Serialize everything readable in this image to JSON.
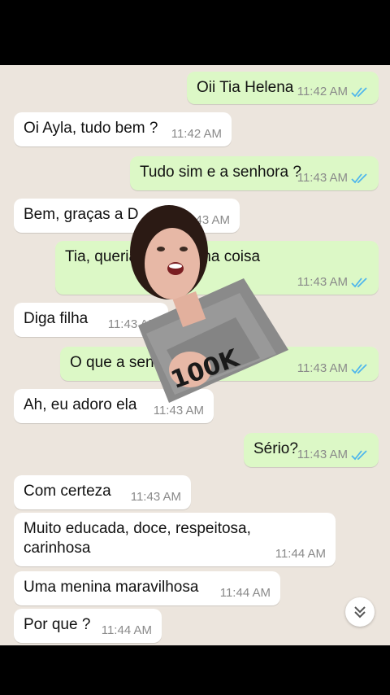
{
  "messages": [
    {
      "id": "m1",
      "dir": "out",
      "text": "Oii Tia Helena",
      "time": "11:42 AM",
      "read": true
    },
    {
      "id": "m2",
      "dir": "in",
      "text": "Oi Ayla, tudo bem ?",
      "time": "11:42 AM"
    },
    {
      "id": "m3",
      "dir": "out",
      "text": "Tudo sim e a senhora ?",
      "time": "11:43 AM",
      "read": true
    },
    {
      "id": "m4",
      "dir": "in",
      "text": "Bem, graças a D",
      "time": "11:43 AM"
    },
    {
      "id": "m5",
      "dir": "out",
      "text": "Tia, queria ... ntar uma coisa",
      "time": "11:43 AM",
      "read": true
    },
    {
      "id": "m6",
      "dir": "in",
      "text": "Diga filha",
      "time": "11:43 AM"
    },
    {
      "id": "m7",
      "dir": "out",
      "text": "O que a sen... na ?",
      "time": "11:43 AM",
      "read": true
    },
    {
      "id": "m8",
      "dir": "in",
      "text": "Ah, eu adoro ela",
      "time": "11:43 AM"
    },
    {
      "id": "m9",
      "dir": "out",
      "text": "Sério?",
      "time": "11:43 AM",
      "read": true
    },
    {
      "id": "m10",
      "dir": "in",
      "text": "Com certeza",
      "time": "11:43 AM"
    },
    {
      "id": "m11",
      "dir": "in",
      "text": "Muito educada, doce, respeitosa, carinhosa",
      "time": "11:44 AM"
    },
    {
      "id": "m12",
      "dir": "in",
      "text": "Uma menina maravilhosa",
      "time": "11:44 AM"
    },
    {
      "id": "m13",
      "dir": "in",
      "text": "Por que ?",
      "time": "11:44 AM"
    }
  ],
  "colors": {
    "incoming": "#ffffff",
    "outgoing": "#dcf8c6",
    "read_ticks": "#4fb6ec",
    "background": "#ece5dd"
  },
  "icons": {
    "read_receipt": "double-check-icon",
    "scroll_down": "double-chevron-down-icon"
  }
}
